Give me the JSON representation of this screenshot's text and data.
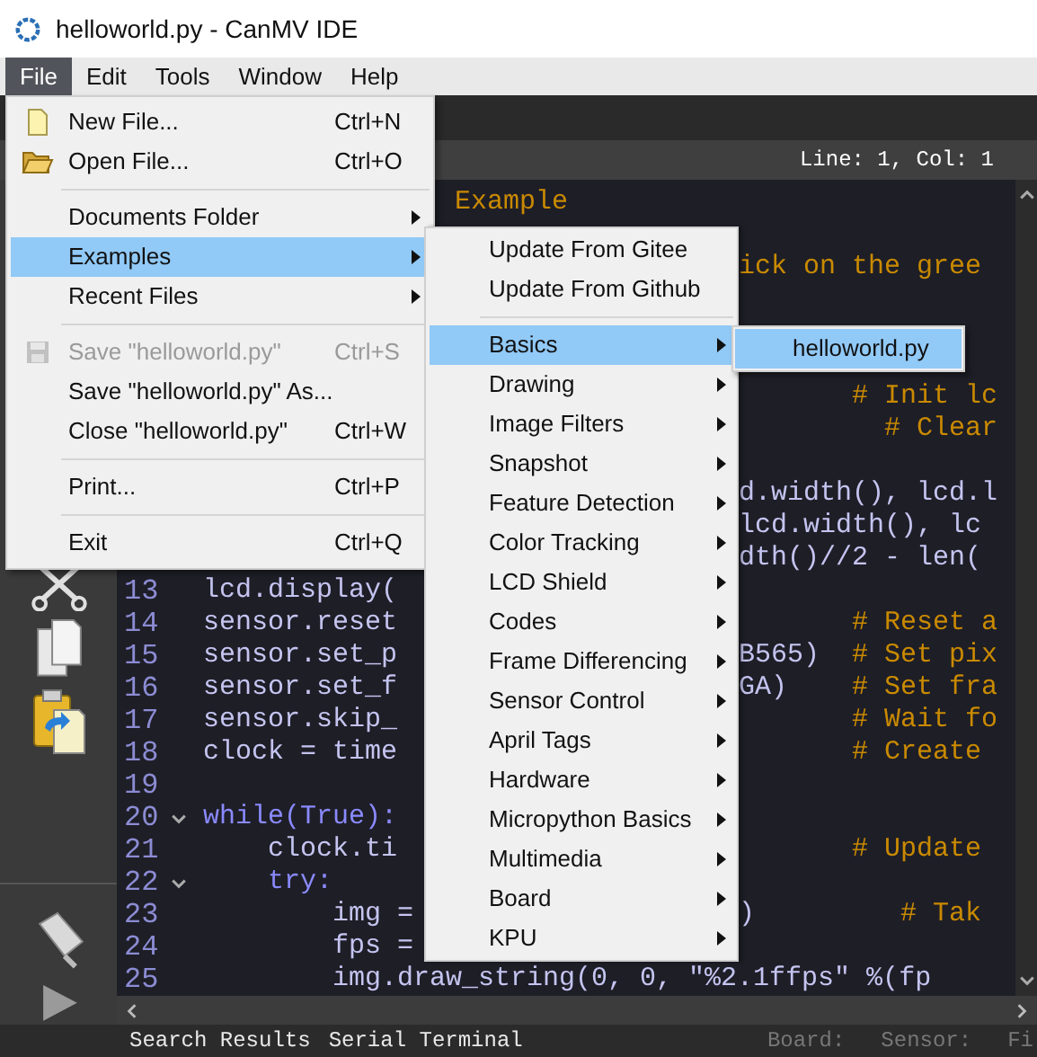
{
  "window": {
    "title": "helloworld.py - CanMV IDE"
  },
  "menu_bar": [
    {
      "label": "File",
      "selected": true
    },
    {
      "label": "Edit",
      "selected": false
    },
    {
      "label": "Tools",
      "selected": false
    },
    {
      "label": "Window",
      "selected": false
    },
    {
      "label": "Help",
      "selected": false
    }
  ],
  "file_menu": [
    {
      "kind": "item",
      "label": "New File...",
      "shortcut": "Ctrl+N",
      "submenu": false,
      "disabled": false,
      "selected": false
    },
    {
      "kind": "item",
      "label": "Open File...",
      "shortcut": "Ctrl+O",
      "submenu": false,
      "disabled": false,
      "selected": false
    },
    {
      "kind": "separator"
    },
    {
      "kind": "item",
      "label": "Documents Folder",
      "submenu": true,
      "disabled": false,
      "selected": false
    },
    {
      "kind": "item",
      "label": "Examples",
      "submenu": true,
      "disabled": false,
      "selected": true
    },
    {
      "kind": "item",
      "label": "Recent Files",
      "submenu": true,
      "disabled": false,
      "selected": false
    },
    {
      "kind": "separator"
    },
    {
      "kind": "item",
      "label": "Save \"helloworld.py\"",
      "shortcut": "Ctrl+S",
      "submenu": false,
      "disabled": true,
      "selected": false
    },
    {
      "kind": "item",
      "label": "Save \"helloworld.py\" As...",
      "submenu": false,
      "disabled": false,
      "selected": false
    },
    {
      "kind": "item",
      "label": "Close \"helloworld.py\"",
      "shortcut": "Ctrl+W",
      "submenu": false,
      "disabled": false,
      "selected": false
    },
    {
      "kind": "separator"
    },
    {
      "kind": "item",
      "label": "Print...",
      "shortcut": "Ctrl+P",
      "submenu": false,
      "disabled": false,
      "selected": false
    },
    {
      "kind": "separator"
    },
    {
      "kind": "item",
      "label": "Exit",
      "shortcut": "Ctrl+Q",
      "submenu": false,
      "disabled": false,
      "selected": false
    }
  ],
  "examples_menu": [
    {
      "kind": "item",
      "label": "Update From Gitee",
      "submenu": false,
      "selected": false
    },
    {
      "kind": "item",
      "label": "Update From Github",
      "submenu": false,
      "selected": false
    },
    {
      "kind": "separator"
    },
    {
      "kind": "item",
      "label": "Basics",
      "submenu": true,
      "selected": true
    },
    {
      "kind": "item",
      "label": "Drawing",
      "submenu": true,
      "selected": false
    },
    {
      "kind": "item",
      "label": "Image Filters",
      "submenu": true,
      "selected": false
    },
    {
      "kind": "item",
      "label": "Snapshot",
      "submenu": true,
      "selected": false
    },
    {
      "kind": "item",
      "label": "Feature Detection",
      "submenu": true,
      "selected": false
    },
    {
      "kind": "item",
      "label": "Color Tracking",
      "submenu": true,
      "selected": false
    },
    {
      "kind": "item",
      "label": "LCD Shield",
      "submenu": true,
      "selected": false
    },
    {
      "kind": "item",
      "label": "Codes",
      "submenu": true,
      "selected": false
    },
    {
      "kind": "item",
      "label": "Frame Differencing",
      "submenu": true,
      "selected": false
    },
    {
      "kind": "item",
      "label": "Sensor Control",
      "submenu": true,
      "selected": false
    },
    {
      "kind": "item",
      "label": "April Tags",
      "submenu": true,
      "selected": false
    },
    {
      "kind": "item",
      "label": "Hardware",
      "submenu": true,
      "selected": false
    },
    {
      "kind": "item",
      "label": "Micropython Basics",
      "submenu": true,
      "selected": false
    },
    {
      "kind": "item",
      "label": "Multimedia",
      "submenu": true,
      "selected": false
    },
    {
      "kind": "item",
      "label": "Board",
      "submenu": true,
      "selected": false
    },
    {
      "kind": "item",
      "label": "KPU",
      "submenu": true,
      "selected": false
    }
  ],
  "basics_menu": [
    {
      "label": "helloworld.py",
      "selected": true
    }
  ],
  "cursor_position": "Line: 1, Col: 1",
  "editor": {
    "upper_lines": [
      {
        "mid": [
          {
            "kind": "comment",
            "text": "Example"
          }
        ]
      },
      {
        "right": [
          {
            "kind": "comment",
            "text": "ick on the gree"
          }
        ]
      },
      {
        "right": [
          {
            "kind": "comment",
            "text": "       # Init lc"
          }
        ]
      },
      {
        "right": [
          {
            "kind": "comment",
            "text": "         # Clear"
          }
        ]
      },
      {
        "right": [
          {
            "kind": "code",
            "text": "d.width(), lcd.l"
          }
        ]
      },
      {
        "right": [
          {
            "kind": "code",
            "text": "lcd.width(), lc"
          }
        ]
      },
      {
        "right": [
          {
            "kind": "code",
            "text": "dth()//2 - len("
          }
        ]
      }
    ],
    "lines": [
      {
        "number": "13",
        "fold": false,
        "left": [
          {
            "kind": "code",
            "text": "lcd.display("
          }
        ]
      },
      {
        "number": "14",
        "fold": false,
        "left": [
          {
            "kind": "code",
            "text": "sensor.reset"
          }
        ],
        "right": [
          {
            "kind": "comment",
            "text": "       # Reset a"
          }
        ]
      },
      {
        "number": "15",
        "fold": false,
        "left": [
          {
            "kind": "code",
            "text": "sensor.set_p"
          }
        ],
        "right": [
          {
            "kind": "code",
            "text": "B565)"
          },
          {
            "kind": "comment",
            "text": "  # Set pix"
          }
        ]
      },
      {
        "number": "16",
        "fold": false,
        "left": [
          {
            "kind": "code",
            "text": "sensor.set_f"
          }
        ],
        "right": [
          {
            "kind": "code",
            "text": "GA)"
          },
          {
            "kind": "comment",
            "text": "    # Set fra"
          }
        ]
      },
      {
        "number": "17",
        "fold": false,
        "left": [
          {
            "kind": "code",
            "text": "sensor.skip_"
          }
        ],
        "right": [
          {
            "kind": "comment",
            "text": "       # Wait fo"
          }
        ]
      },
      {
        "number": "18",
        "fold": false,
        "left": [
          {
            "kind": "code",
            "text": "clock = time"
          }
        ],
        "right": [
          {
            "kind": "comment",
            "text": "       # Create"
          }
        ]
      },
      {
        "number": "19",
        "fold": false
      },
      {
        "number": "20",
        "fold": true,
        "left": [
          {
            "kind": "keyword",
            "text": "while(True):"
          }
        ]
      },
      {
        "number": "21",
        "fold": false,
        "left": [
          {
            "kind": "code",
            "text": "    clock.ti"
          }
        ],
        "right": [
          {
            "kind": "comment",
            "text": "       # Update"
          }
        ]
      },
      {
        "number": "22",
        "fold": true,
        "left": [
          {
            "kind": "keyword",
            "text": "    try:"
          }
        ]
      },
      {
        "number": "23",
        "fold": false,
        "left": [
          {
            "kind": "code",
            "text": "        img ="
          }
        ],
        "right": [
          {
            "kind": "code",
            "text": ")"
          },
          {
            "kind": "comment",
            "text": "         # Tak"
          }
        ]
      },
      {
        "number": "24",
        "fold": false,
        "left": [
          {
            "kind": "code",
            "text": "        fps ="
          }
        ]
      },
      {
        "number": "25",
        "fold": false,
        "full": [
          {
            "kind": "code",
            "text": "        img.draw_string(0, 0, \"%2.1ffps\" %(fp"
          }
        ]
      }
    ]
  },
  "bottom_tabs": [
    "Search Results",
    "Serial Terminal"
  ],
  "status_labels": [
    "Board:",
    "Sensor:",
    "Fi"
  ]
}
